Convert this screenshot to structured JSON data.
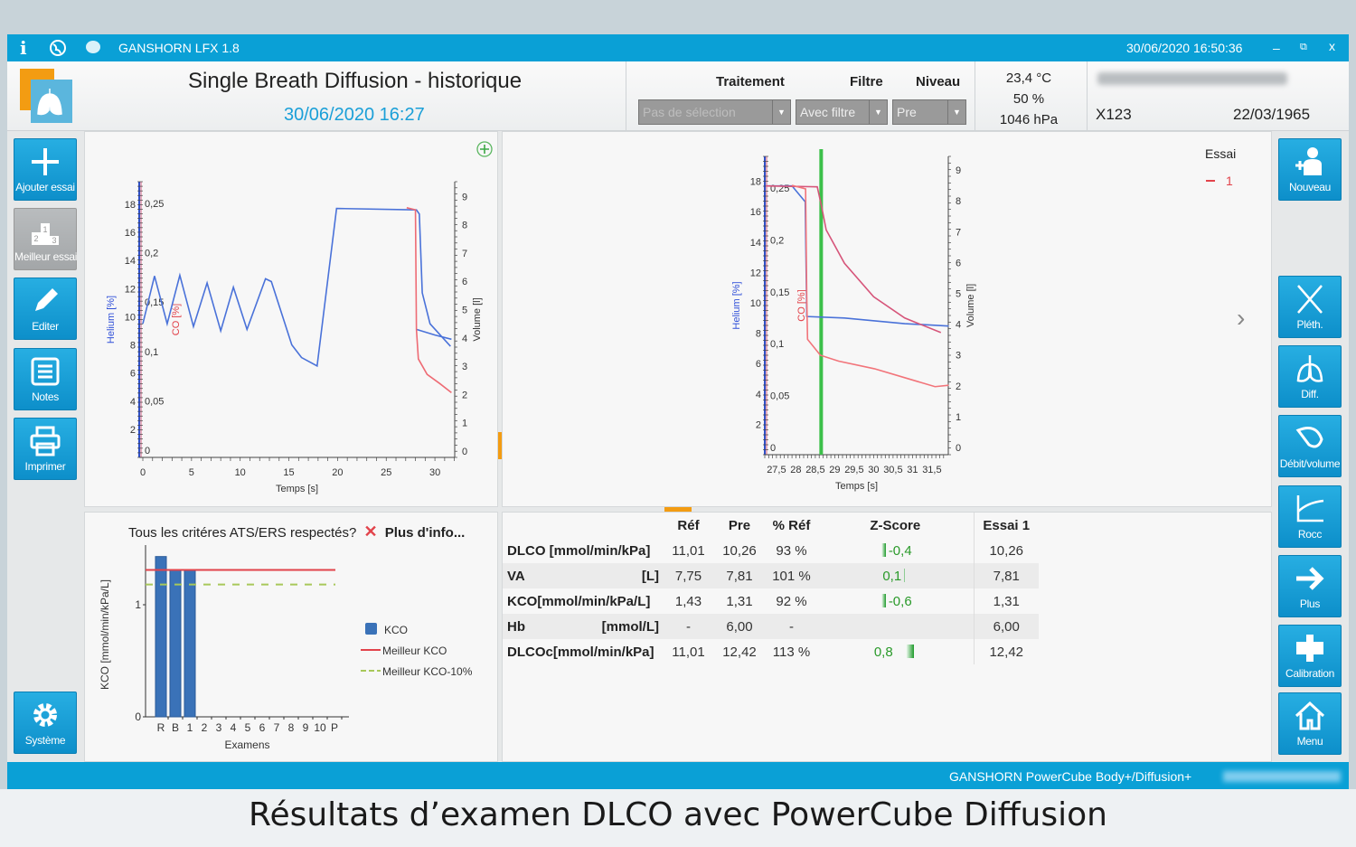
{
  "titlebar": {
    "app": "GANSHORN LFX 1.8",
    "datetime": "30/06/2020 16:50:36",
    "icons": [
      "info-icon",
      "globe-icon",
      "chat-icon"
    ],
    "minimize": "–",
    "restore": "⧉",
    "close": "x"
  },
  "header": {
    "title": "Single Breath Diffusion - historique",
    "date": "30/06/2020 16:27",
    "traitement_label": "Traitement",
    "filtre_label": "Filtre",
    "niveau_label": "Niveau",
    "traitement_value": "Pas de sélection",
    "filtre_value": "Avec filtre",
    "niveau_value": "Pre",
    "temperature": "23,4 °C",
    "humidity": "50 %",
    "pressure": "1046 hPa",
    "patient_id": "X123",
    "birthdate": "22/03/1965"
  },
  "left_sidebar": [
    {
      "label": "Ajouter essai",
      "icon": "plus-icon"
    },
    {
      "label": "Meilleur essai",
      "icon": "podium-icon",
      "disabled": true
    },
    {
      "label": "Editer",
      "icon": "pencil-icon"
    },
    {
      "label": "Notes",
      "icon": "notes-icon"
    },
    {
      "label": "Imprimer",
      "icon": "printer-icon"
    },
    {
      "label": "Système",
      "icon": "gear-icon"
    }
  ],
  "right_sidebar": [
    {
      "label": "Nouveau",
      "icon": "new-patient-icon"
    },
    {
      "label": "Pléth.",
      "icon": "scissors-icon"
    },
    {
      "label": "Diff.",
      "icon": "lungs-icon"
    },
    {
      "label": "Débit/volume",
      "icon": "flow-volume-icon"
    },
    {
      "label": "Rocc",
      "icon": "rocc-icon"
    },
    {
      "label": "Plus",
      "icon": "arrow-right-icon"
    },
    {
      "label": "Calibration",
      "icon": "calibration-icon"
    },
    {
      "label": "Menu",
      "icon": "home-icon"
    }
  ],
  "ats": {
    "question": "Tous les critéres ATS/ERS respectés?",
    "status_icon": "✕",
    "more": "Plus d'info..."
  },
  "right_chart_legend": {
    "title": "Essai",
    "entries": [
      "1"
    ]
  },
  "results": {
    "headers": [
      "",
      "Réf",
      "Pre",
      "% Réf",
      "Z-Score",
      "Essai  1"
    ],
    "rows": [
      {
        "param": "DLCO [mmol/min/kPa]",
        "unit": "",
        "ref": "11,01",
        "pre": "10,26",
        "pct": "93 %",
        "z": "-0,4",
        "essai": "10,26"
      },
      {
        "param": "VA",
        "unit": "[L]",
        "ref": "7,75",
        "pre": "7,81",
        "pct": "101 %",
        "z": "0,1",
        "essai": "7,81"
      },
      {
        "param": "KCO[mmol/min/kPa/L]",
        "unit": "",
        "ref": "1,43",
        "pre": "1,31",
        "pct": "92 %",
        "z": "-0,6",
        "essai": "1,31"
      },
      {
        "param": "Hb",
        "unit": "[mmol/L]",
        "ref": "-",
        "pre": "6,00",
        "pct": "-",
        "z": "",
        "essai": "6,00"
      },
      {
        "param": "DLCOc[mmol/min/kPa]",
        "unit": "",
        "ref": "11,01",
        "pre": "12,42",
        "pct": "113 %",
        "z": "0,8",
        "essai": "12,42"
      }
    ]
  },
  "status": {
    "product": "GANSHORN PowerCube Body+/Diffusion+"
  },
  "caption": "Résultats d’examen DLCO avec PowerCube Diffusion",
  "chart_data": [
    {
      "type": "line",
      "xlabel": "Temps [s]",
      "ylabel": "Helium [%]",
      "ylabel2": "CO [%]",
      "ylabel3": "Volume [l]",
      "xlim": [
        0,
        32
      ],
      "xticks": [
        0,
        5,
        10,
        15,
        20,
        25,
        30
      ],
      "yticks": [
        2,
        4,
        6,
        8,
        10,
        12,
        14,
        16,
        18
      ],
      "y2ticks": [
        "0",
        "0,05",
        "0,1",
        "0,15",
        "0,2",
        "0,25"
      ],
      "y3ticks": [
        0,
        1,
        2,
        3,
        4,
        5,
        6,
        7,
        8,
        9
      ],
      "series": [
        {
          "color": "#4a72d9",
          "x": [
            0,
            1.2,
            2.5,
            3.8,
            5.2,
            6.6,
            8,
            9.3,
            10.7,
            12.6,
            13.2,
            15.3,
            16.3,
            17.9,
            19.9,
            28.1,
            28.4,
            28.7,
            29.5,
            31.6
          ],
          "y": [
            9.5,
            12.9,
            9.5,
            12.95,
            9.3,
            12.4,
            9.0,
            12.1,
            9.1,
            12.7,
            12.5,
            8.0,
            7.1,
            6.5,
            17.7,
            17.6,
            17.3,
            11.7,
            9.5,
            7.9
          ]
        },
        {
          "color": "#4a72d9",
          "x": [
            28.1,
            30,
            31.7
          ],
          "y": [
            9.1,
            8.7,
            8.4
          ]
        },
        {
          "color": "#ee6b74",
          "x": [
            27.1,
            28,
            28.1,
            28.3,
            29.2,
            30.5,
            31.7
          ],
          "y": [
            17.75,
            17.6,
            9.1,
            7.0,
            5.9,
            5.25,
            4.6
          ]
        }
      ]
    },
    {
      "type": "line",
      "xlabel": "Temps [s]",
      "ylabel": "Helium [%]",
      "ylabel2": "CO [%]",
      "ylabel3": "Volume [l]",
      "xlim": [
        27.2,
        31.9
      ],
      "xticks": [
        "27,5",
        "28",
        "28,5",
        "29",
        "29,5",
        "30",
        "30,5",
        "31",
        "31,5"
      ],
      "yticks": [
        2,
        4,
        6,
        8,
        10,
        12,
        14,
        16,
        18
      ],
      "y2ticks": [
        "0",
        "0,05",
        "0,1",
        "0,15",
        "0,2",
        "0,25"
      ],
      "y3ticks": [
        0,
        1,
        2,
        3,
        4,
        5,
        6,
        7,
        8,
        9
      ],
      "marker_x": 28.65,
      "marker_color": "#3cc04a",
      "series": [
        {
          "color": "#4a72d9",
          "x": [
            27.23,
            27.9,
            28.24,
            28.28,
            29.25,
            30.8,
            31.93
          ],
          "y": [
            17.7,
            17.7,
            16.65,
            9.1,
            9.0,
            8.63,
            8.47
          ]
        },
        {
          "color": "#d6557a",
          "x": [
            27.23,
            28.55,
            28.66,
            28.78,
            29.25,
            30.0,
            30.8,
            31.73
          ],
          "y": [
            17.7,
            17.64,
            16.36,
            14.8,
            12.6,
            10.4,
            9.0,
            8.04
          ]
        },
        {
          "color": "#f2747a",
          "x": [
            27.9,
            28.25,
            28.28,
            28.3,
            28.63,
            29.1,
            30.02,
            30.8,
            31.58,
            31.93
          ],
          "y": [
            17.74,
            17.5,
            10.4,
            7.6,
            6.55,
            6.16,
            5.66,
            5.07,
            4.48,
            4.57
          ]
        }
      ]
    },
    {
      "type": "bar",
      "xlabel": "Examens",
      "ylabel": "KCO [mmol/min/kPa/L]",
      "categories": [
        "R",
        "B",
        "1",
        "2",
        "3",
        "4",
        "5",
        "6",
        "7",
        "8",
        "9",
        "10",
        "P"
      ],
      "values": [
        1.43,
        1.31,
        1.31,
        null,
        null,
        null,
        null,
        null,
        null,
        null,
        null,
        null,
        null
      ],
      "yticks": [
        "0",
        "1"
      ],
      "ylim": [
        0,
        1.5
      ],
      "legend": [
        "KCO",
        "Meilleur KCO",
        "Meilleur KCO-10%"
      ],
      "best": 1.31,
      "best_minus_10": 1.18,
      "colors": {
        "bar": "#3a72b8",
        "best": "#e2434b",
        "best10": "#a8c85a"
      }
    }
  ]
}
